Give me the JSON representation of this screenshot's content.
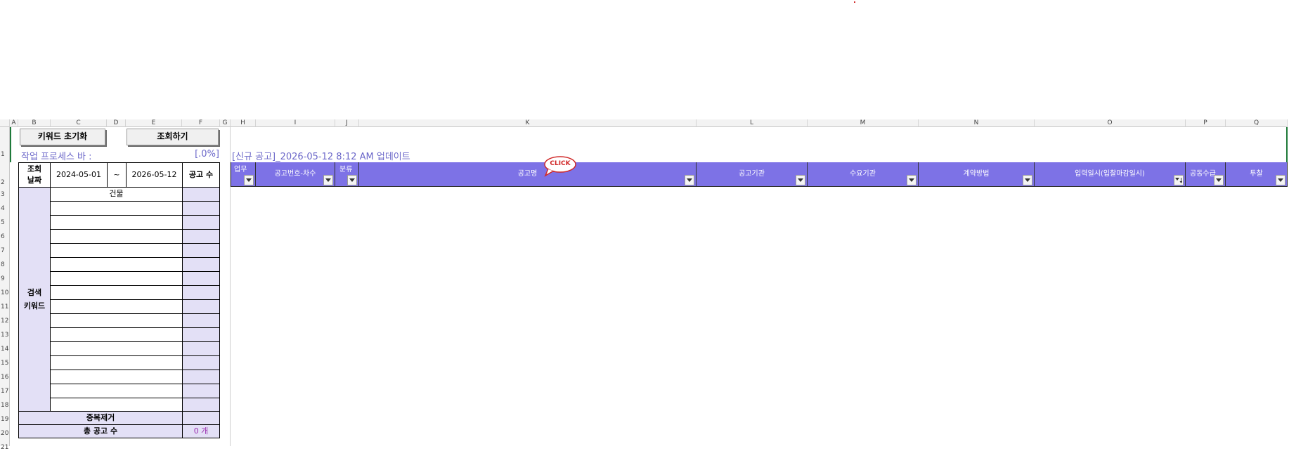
{
  "column_letters": [
    "A",
    "B",
    "C",
    "D",
    "E",
    "F",
    "G",
    "H",
    "I",
    "J",
    "K",
    "L",
    "M",
    "N",
    "O",
    "P",
    "Q"
  ],
  "row_numbers": [
    "1",
    "2",
    "3",
    "4",
    "5",
    "6",
    "7",
    "8",
    "9",
    "10",
    "11",
    "12",
    "13",
    "14",
    "15",
    "16",
    "17",
    "18",
    "19",
    "20",
    "21"
  ],
  "buttons": {
    "reset_label": "키워드 초기화",
    "search_label": "조회하기"
  },
  "progress": {
    "label": "작업 프로세스 바 :",
    "value_text": "[.0%]",
    "fraction": 0.0
  },
  "update_text": "[신규 공고]_2026-05-12 8:12 AM 업데이트",
  "query": {
    "date_label_1": "조회",
    "date_label_2": "날짜",
    "start_date": "2024-05-01",
    "tilde": "~",
    "end_date": "2026-05-12",
    "count_header": "공고 수",
    "keyword_label_1": "검색",
    "keyword_label_2": "키워드",
    "keywords": [
      "건물",
      "",
      "",
      "",
      "",
      "",
      "",
      "",
      "",
      "",
      "",
      "",
      "",
      "",
      "",
      ""
    ],
    "dedup_label": "중복제거",
    "total_label": "총 공고 수",
    "total_value": "0 개"
  },
  "table_headers": [
    "업무",
    "공고번호-차수",
    "분류",
    "공고명",
    "공고기관",
    "수요기관",
    "계약방법",
    "입력일시(입찰마감일시)",
    "공동수급",
    "투찰"
  ],
  "callout": "CLICK",
  "colors": {
    "header_purple": "#7d72e6",
    "lavender": "#e3e0f6",
    "accent_text": "#6b67c9",
    "total_value": "#9b2fb0",
    "callout_red": "#d02828"
  }
}
